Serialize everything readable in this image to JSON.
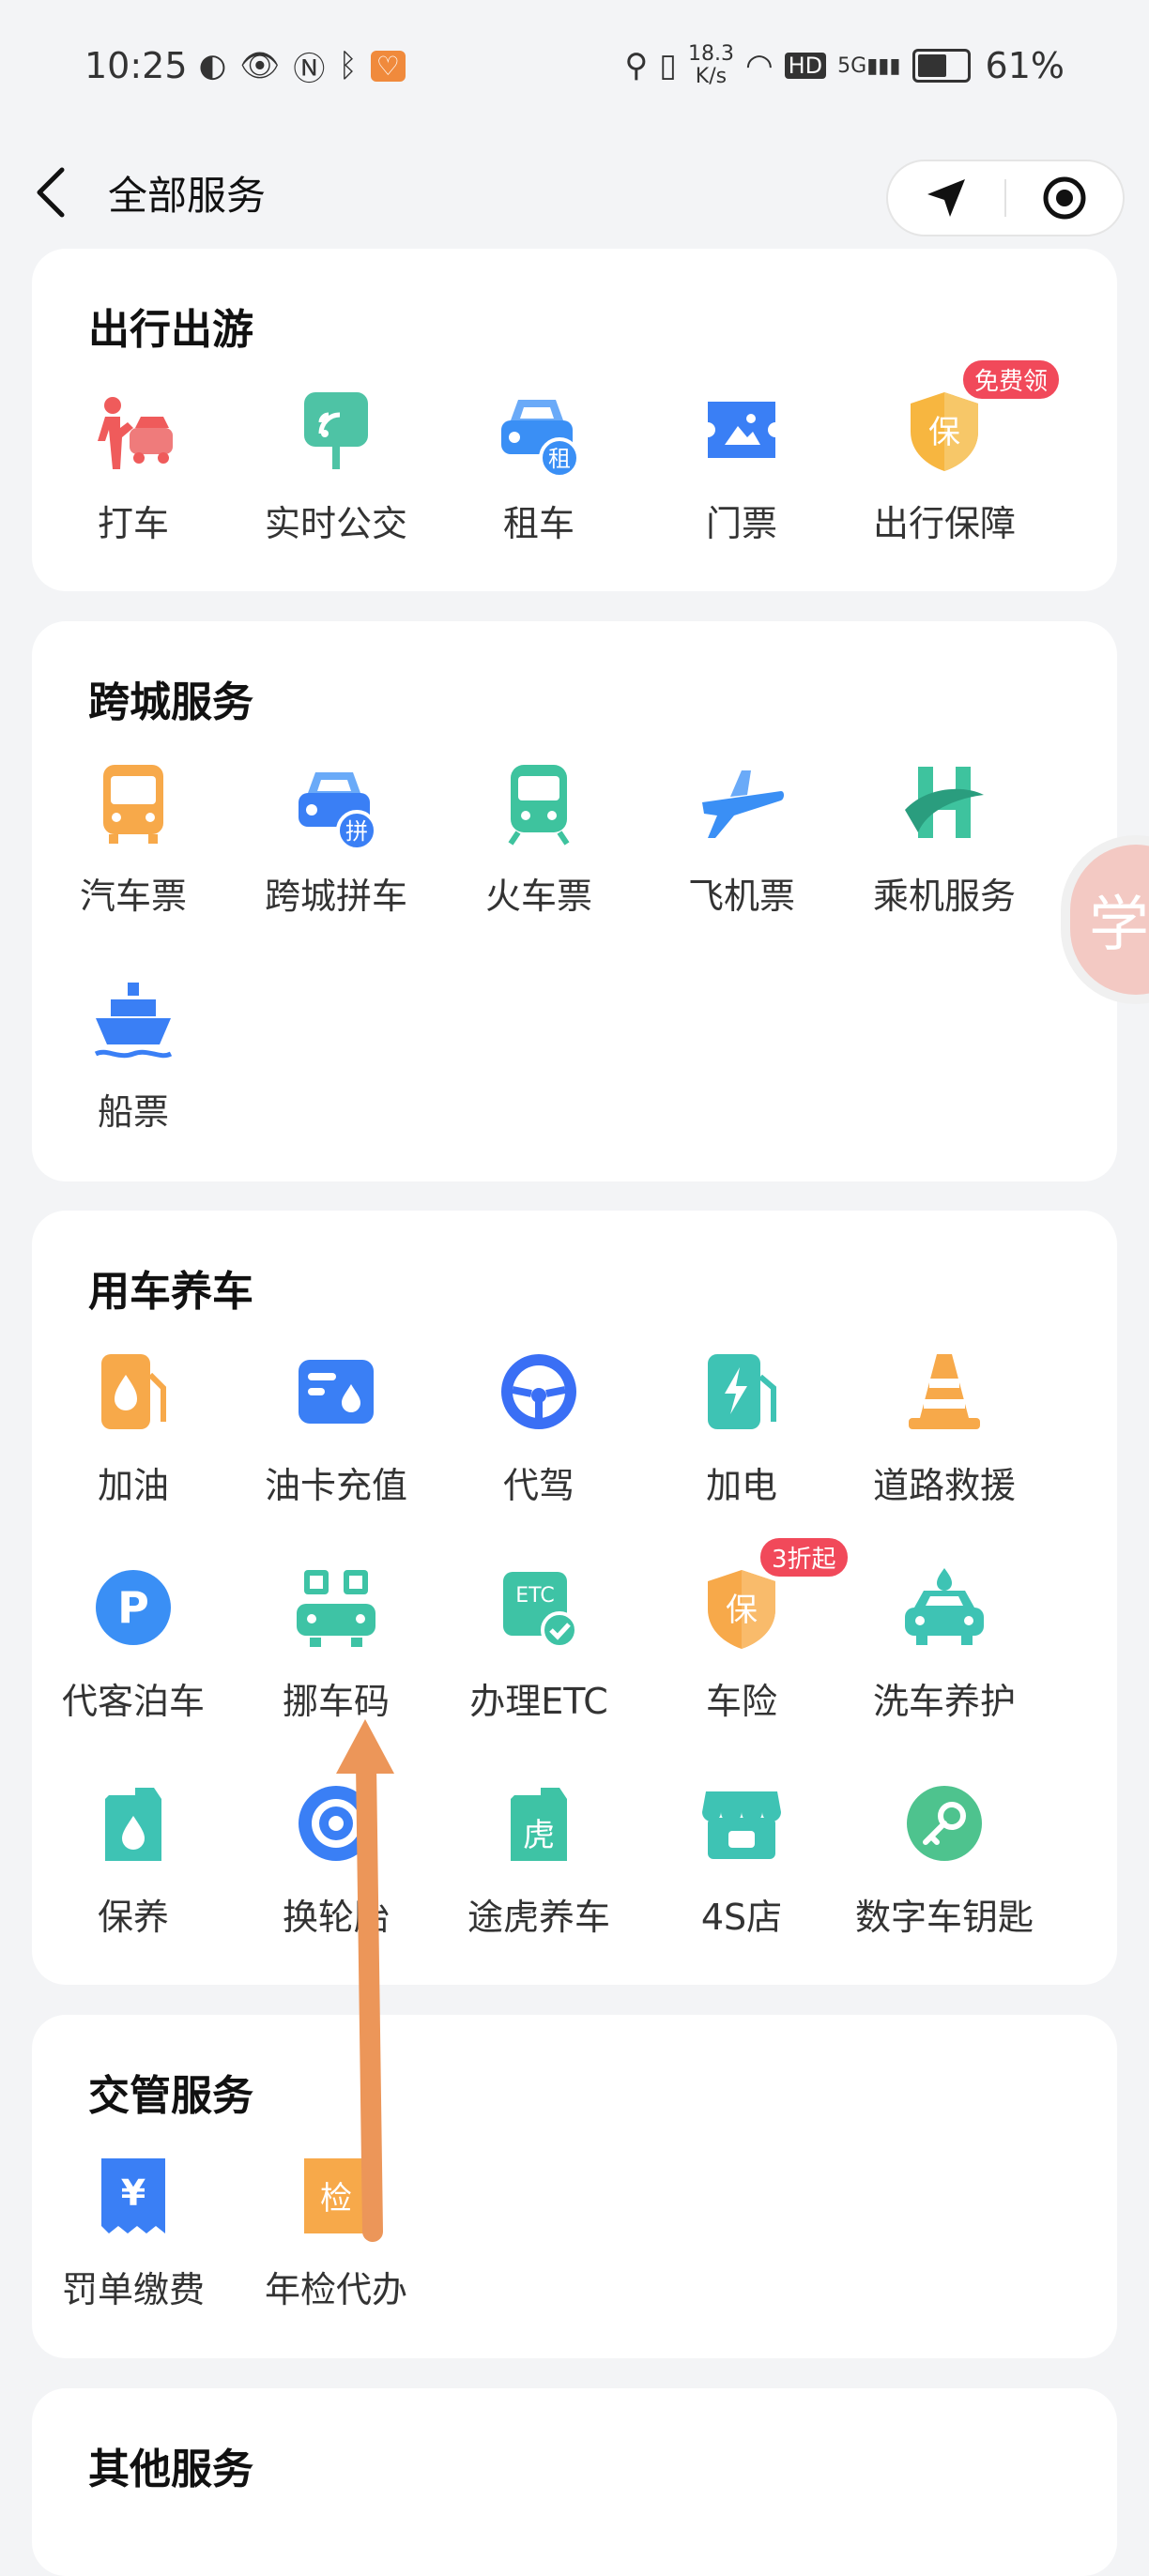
{
  "status_bar": {
    "time": "10:25",
    "speed_value": "18.3",
    "speed_unit": "K/s",
    "battery": "61%",
    "battery_level": 0.61,
    "net": "5G",
    "hd": "HD"
  },
  "nav": {
    "title": "全部服务"
  },
  "sections": [
    {
      "title": "出行出游",
      "items": [
        {
          "label": "打车",
          "icon": "taxi-hail-icon"
        },
        {
          "label": "实时公交",
          "icon": "bus-stop-sign-icon"
        },
        {
          "label": "租车",
          "icon": "car-rental-icon",
          "tag": "租"
        },
        {
          "label": "门票",
          "icon": "ticket-icon"
        },
        {
          "label": "出行保障",
          "icon": "shield-icon",
          "tag": "保",
          "badge": "免费领"
        }
      ]
    },
    {
      "title": "跨城服务",
      "items": [
        {
          "label": "汽车票",
          "icon": "bus-icon"
        },
        {
          "label": "跨城拼车",
          "icon": "carpool-icon",
          "tag": "拼"
        },
        {
          "label": "火车票",
          "icon": "train-icon"
        },
        {
          "label": "飞机票",
          "icon": "plane-icon"
        },
        {
          "label": "乘机服务",
          "icon": "airport-service-icon"
        },
        {
          "label": "船票",
          "icon": "ship-icon"
        }
      ]
    },
    {
      "title": "用车养车",
      "items": [
        {
          "label": "加油",
          "icon": "fuel-icon"
        },
        {
          "label": "油卡充值",
          "icon": "fuel-card-icon"
        },
        {
          "label": "代驾",
          "icon": "steering-wheel-icon"
        },
        {
          "label": "加电",
          "icon": "ev-charger-icon"
        },
        {
          "label": "道路救援",
          "icon": "traffic-cone-icon"
        },
        {
          "label": "代客泊车",
          "icon": "parking-icon",
          "tag": "P"
        },
        {
          "label": "挪车码",
          "icon": "qr-code-car-icon"
        },
        {
          "label": "办理ETC",
          "icon": "etc-icon",
          "tag": "ETC"
        },
        {
          "label": "车险",
          "icon": "insurance-shield-icon",
          "tag": "保",
          "badge": "3折起"
        },
        {
          "label": "洗车养护",
          "icon": "car-wash-icon"
        },
        {
          "label": "保养",
          "icon": "oil-can-icon"
        },
        {
          "label": "换轮胎",
          "icon": "tire-icon"
        },
        {
          "label": "途虎养车",
          "icon": "tuhu-icon",
          "tag": "虎"
        },
        {
          "label": "4S店",
          "icon": "shop-icon"
        },
        {
          "label": "数字车钥匙",
          "icon": "car-key-icon"
        }
      ]
    },
    {
      "title": "交管服务",
      "items": [
        {
          "label": "罚单缴费",
          "icon": "fine-receipt-icon",
          "tag": "¥"
        },
        {
          "label": "年检代办",
          "icon": "inspection-icon",
          "tag": "检"
        }
      ]
    },
    {
      "title": "其他服务",
      "items": []
    }
  ],
  "float_button": {
    "text": "学"
  }
}
